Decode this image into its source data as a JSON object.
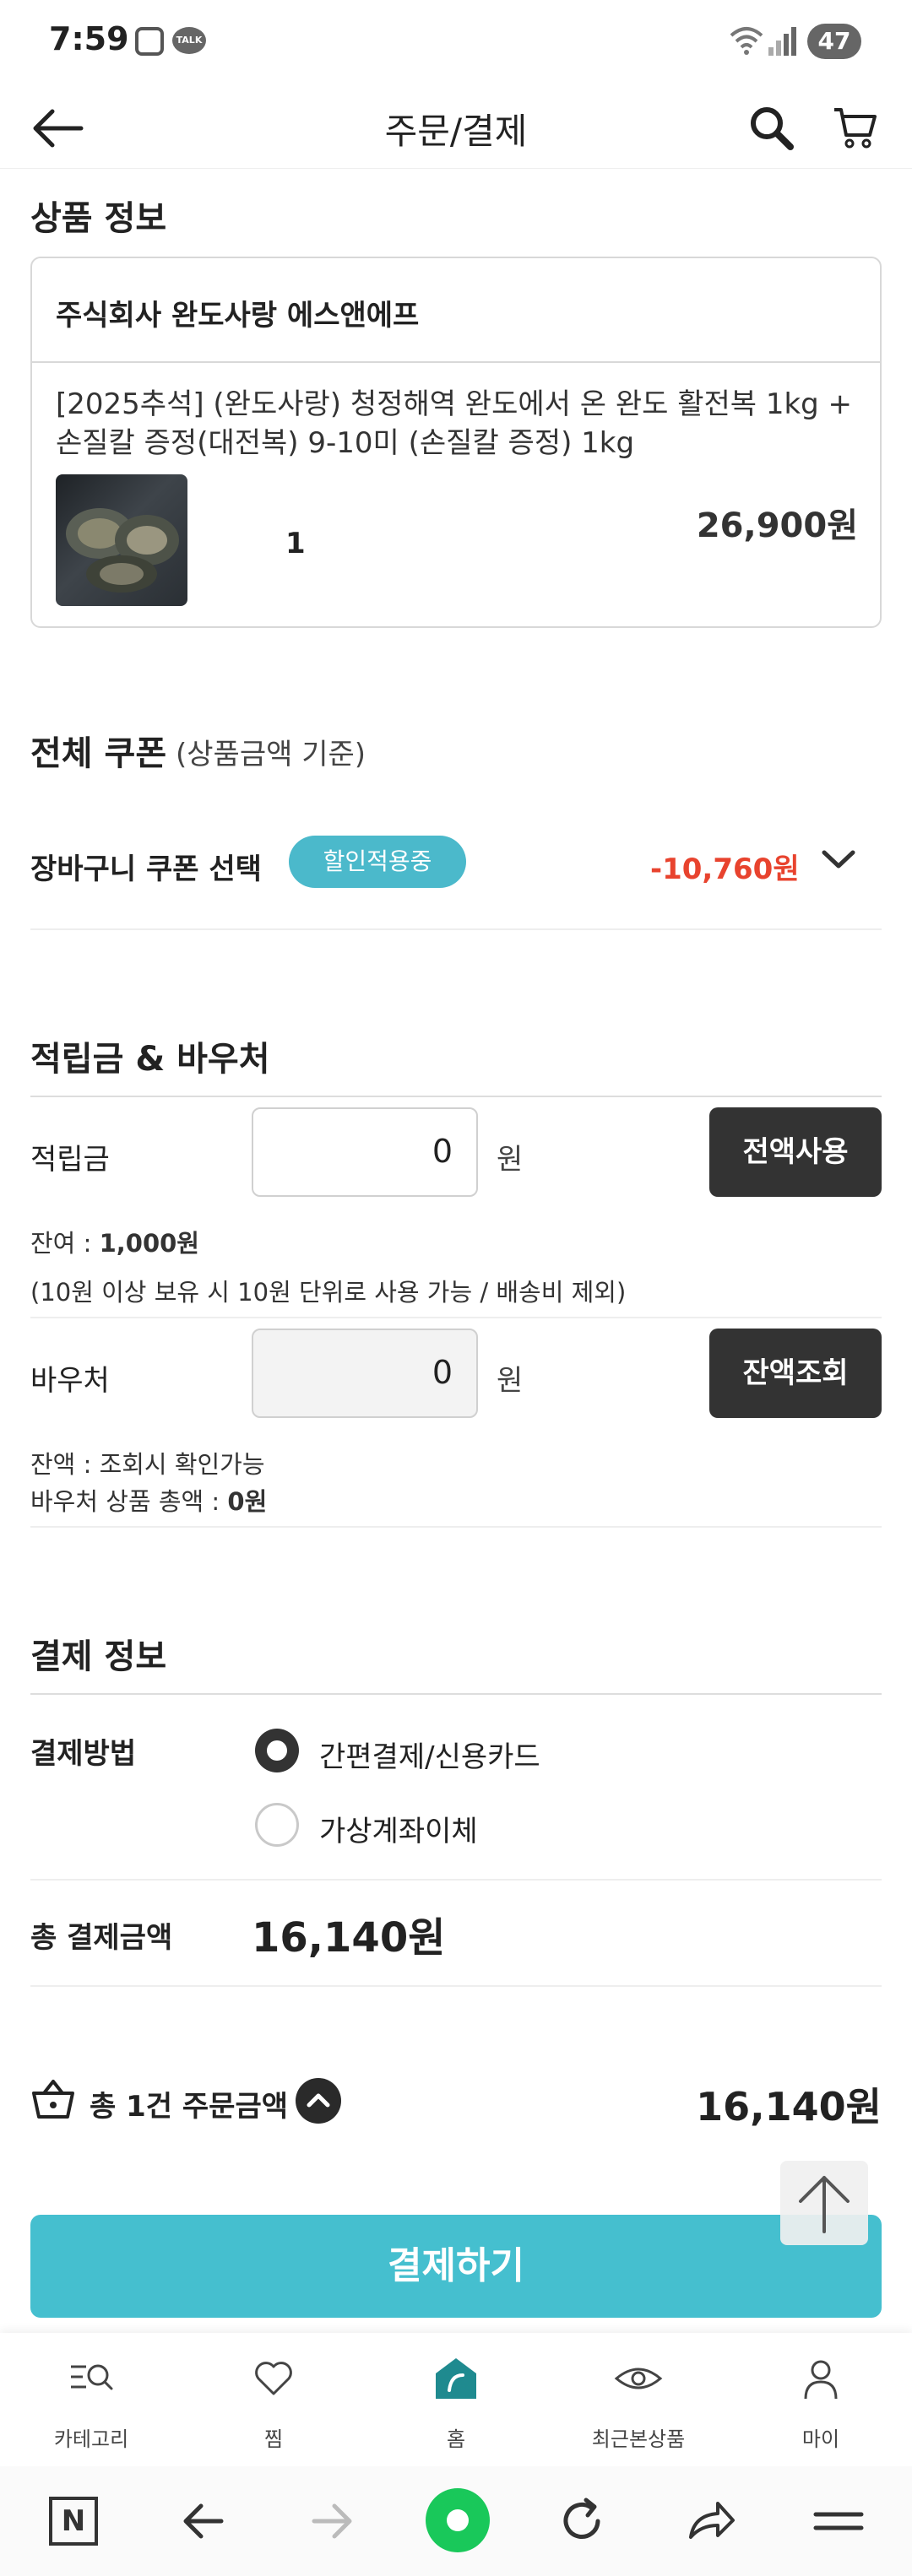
{
  "status_bar": {
    "time": "7:59",
    "talk_label": "TALK",
    "battery": "47"
  },
  "header": {
    "title": "주문/결제"
  },
  "product_info": {
    "section_title": "상품 정보",
    "seller": "주식회사 완도사랑 에스앤에프",
    "product_name": "[2025추석] (완도사랑) 청정해역 완도에서 온 완도 활전복 1kg + 손질칼 증정(대전복) 9-10미 (손질칼 증정) 1kg",
    "quantity": "1",
    "price": "26,900원"
  },
  "coupon": {
    "section_title": "전체 쿠폰",
    "section_subtitle": "(상품금액 기준)",
    "label": "장바구니 쿠폰 선택",
    "badge": "할인적용중",
    "discount": "-10,760원"
  },
  "points": {
    "section_title": "적립금 & 바우처",
    "points_label": "적립금",
    "points_value": "0",
    "unit": "원",
    "use_all_button": "전액사용",
    "balance_prefix": "잔여 : ",
    "balance_value": "1,000원",
    "note": "(10원 이상 보유 시 10원 단위로 사용 가능 / 배송비 제외)",
    "voucher_label": "바우처",
    "voucher_value": "0",
    "check_balance_button": "잔액조회",
    "voucher_balance_text": "잔액 : 조회시 확인가능",
    "voucher_total_prefix": "바우처 상품 총액 : ",
    "voucher_total_value": "0원"
  },
  "payment": {
    "section_title": "결제 정보",
    "method_label": "결제방법",
    "options": [
      {
        "label": "간편결제/신용카드",
        "selected": true
      },
      {
        "label": "가상계좌이체",
        "selected": false
      }
    ],
    "total_label": "총 결제금액",
    "total_value": "16,140원"
  },
  "order_summary": {
    "label": "총 1건 주문금액",
    "value": "16,140원",
    "pay_button": "결제하기"
  },
  "bottom_nav": {
    "items": [
      {
        "label": "카테고리",
        "icon": "category-search-icon"
      },
      {
        "label": "찜",
        "icon": "heart-icon"
      },
      {
        "label": "홈",
        "icon": "home-icon"
      },
      {
        "label": "최근본상품",
        "icon": "eye-icon"
      },
      {
        "label": "마이",
        "icon": "person-icon"
      }
    ]
  },
  "system_bar": {
    "n_label": "N"
  },
  "colors": {
    "accent": "#45bfcf",
    "badge": "#4bb9cb",
    "discount": "#e8432e",
    "dark_button": "#333333"
  }
}
